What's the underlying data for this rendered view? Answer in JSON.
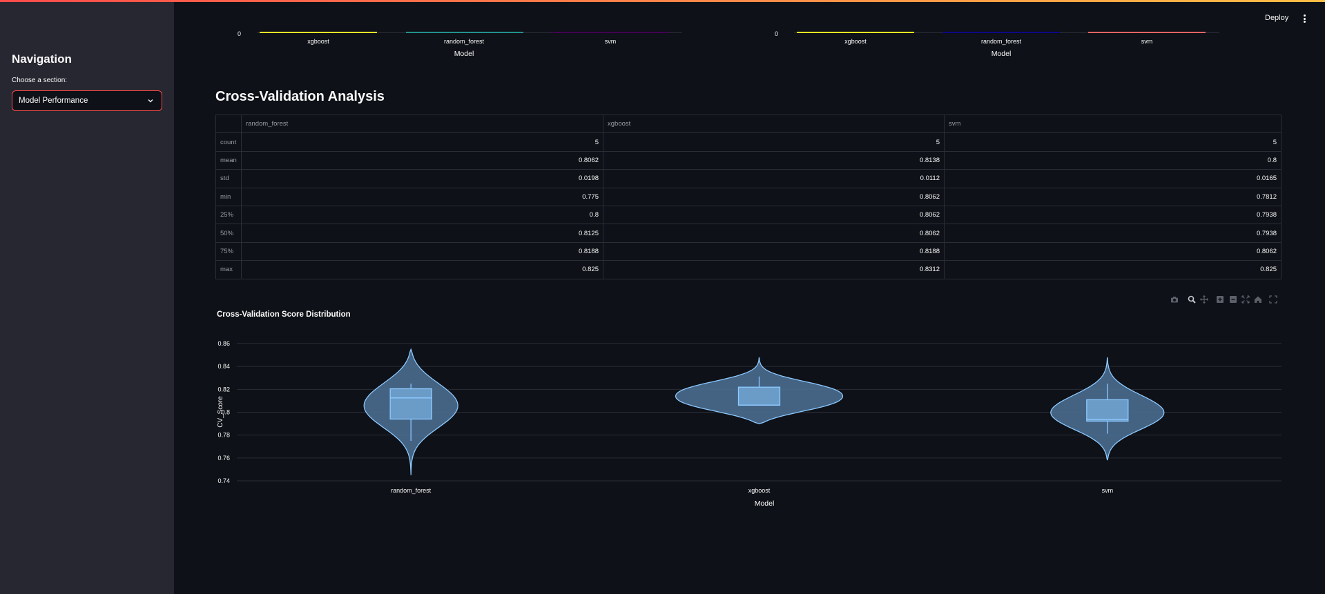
{
  "sidebar": {
    "title": "Navigation",
    "select_label": "Choose a section:",
    "select_value": "Model Performance"
  },
  "header": {
    "deploy_label": "Deploy"
  },
  "top_charts": [
    {
      "y_tick": "0",
      "categories": [
        "xgboost",
        "random_forest",
        "svm"
      ],
      "bar_colors": [
        "#fde725",
        "#21918c",
        "#440154"
      ],
      "xlabel": "Model"
    },
    {
      "y_tick": "0",
      "categories": [
        "xgboost",
        "random_forest",
        "svm"
      ],
      "bar_colors": [
        "#f0f921",
        "#0d0887",
        "#e16462"
      ],
      "xlabel": "Model"
    }
  ],
  "cv_section": {
    "title": "Cross-Validation Analysis",
    "table": {
      "columns": [
        "random_forest",
        "xgboost",
        "svm"
      ],
      "rows": [
        {
          "label": "count",
          "values": [
            "5",
            "5",
            "5"
          ]
        },
        {
          "label": "mean",
          "values": [
            "0.8062",
            "0.8138",
            "0.8"
          ]
        },
        {
          "label": "std",
          "values": [
            "0.0198",
            "0.0112",
            "0.0165"
          ]
        },
        {
          "label": "min",
          "values": [
            "0.775",
            "0.8062",
            "0.7812"
          ]
        },
        {
          "label": "25%",
          "values": [
            "0.8",
            "0.8062",
            "0.7938"
          ]
        },
        {
          "label": "50%",
          "values": [
            "0.8125",
            "0.8062",
            "0.7938"
          ]
        },
        {
          "label": "75%",
          "values": [
            "0.8188",
            "0.8188",
            "0.8062"
          ]
        },
        {
          "label": "max",
          "values": [
            "0.825",
            "0.8312",
            "0.825"
          ]
        }
      ]
    }
  },
  "modebar_icons": [
    "camera-icon",
    "zoom-icon",
    "pan-icon",
    "zoom-in-icon",
    "zoom-out-icon",
    "autoscale-icon",
    "reset-axes-icon",
    "fullscreen-icon"
  ],
  "colors": {
    "accent": "#ff4b4b",
    "violin_fill": "#4a6d8f",
    "violin_line": "#8dc9ff"
  },
  "chart_data": {
    "type": "violin",
    "title": "Cross-Validation Score Distribution",
    "xlabel": "Model",
    "ylabel": "CV_Score",
    "categories": [
      "random_forest",
      "xgboost",
      "svm"
    ],
    "ylim": [
      0.74,
      0.86
    ],
    "yticks": [
      0.74,
      0.76,
      0.78,
      0.8,
      0.82,
      0.84,
      0.86
    ],
    "ytick_labels": [
      "0.74",
      "0.76",
      "0.78",
      "0.8",
      "0.82",
      "0.84",
      "0.86"
    ],
    "grid": true,
    "series": [
      {
        "category": "random_forest",
        "min": 0.775,
        "q1": 0.794,
        "median": 0.8125,
        "q3": 0.8205,
        "max": 0.825,
        "kde_min": 0.745,
        "kde_max": 0.855
      },
      {
        "category": "xgboost",
        "min": 0.8062,
        "q1": 0.8062,
        "median": 0.8062,
        "q3": 0.8219,
        "max": 0.8312,
        "kde_min": 0.79,
        "kde_max": 0.848
      },
      {
        "category": "svm",
        "min": 0.7812,
        "q1": 0.7922,
        "median": 0.7938,
        "q3": 0.8109,
        "max": 0.825,
        "kde_min": 0.758,
        "kde_max": 0.848
      }
    ]
  }
}
